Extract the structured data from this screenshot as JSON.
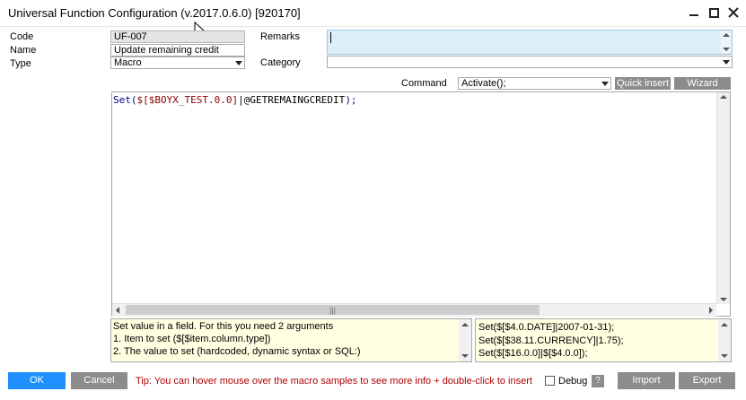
{
  "window": {
    "title": "Universal Function Configuration (v.2017.0.6.0) [920170]"
  },
  "form": {
    "code_label": "Code",
    "code_value": "UF-007",
    "name_label": "Name",
    "name_value": "Update remaining credit",
    "type_label": "Type",
    "type_value": "Macro",
    "remarks_label": "Remarks",
    "remarks_value": "",
    "category_label": "Category",
    "category_value": "",
    "command_label": "Command",
    "command_value": "Activate();"
  },
  "toolbar": {
    "quick_insert_label": "Quick insert",
    "wizard_label": "Wizard"
  },
  "editor": {
    "code_fn": "Set(",
    "code_ref": "$[$BOYX_TEST.0.0]",
    "code_sep": "|",
    "code_arg": "@GETREMAINGCREDIT",
    "code_end": ");",
    "hscroll_glyph": "|||"
  },
  "help": {
    "lines": [
      "Set value in a field. For this you need 2 arguments",
      "1. Item to set ($[$item.column.type])",
      "2. The value to set (hardcoded, dynamic syntax or SQL:)"
    ]
  },
  "samples": {
    "lines": [
      "Set($[$4.0.DATE]|2007-01-31);",
      "Set($[$38.11.CURRENCY]|1.75);",
      "Set($[$16.0.0]|$[$4.0.0]);"
    ]
  },
  "footer": {
    "ok_label": "OK",
    "cancel_label": "Cancel",
    "tip": "Tip: You can hover mouse over the macro samples to see more info + double-click to insert",
    "debug_label": "Debug",
    "help_label": "?",
    "import_label": "Import",
    "export_label": "Export"
  },
  "colors": {
    "ok_blue": "#1e90ff",
    "button_grey": "#8c8c8c",
    "remarks_bg": "#dceef8",
    "help_bg": "#ffffe1",
    "tip_red": "#b00000"
  }
}
